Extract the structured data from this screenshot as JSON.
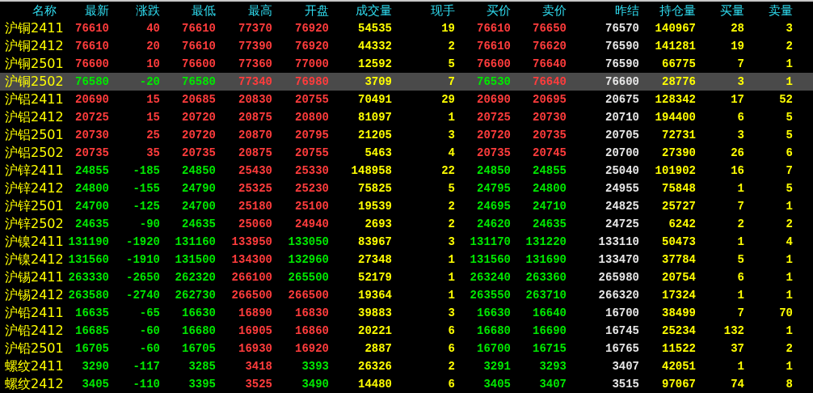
{
  "columns": [
    {
      "label": "名称",
      "kind": "name"
    },
    {
      "label": "最新",
      "kind": "price"
    },
    {
      "label": "涨跌",
      "kind": "price"
    },
    {
      "label": "最低",
      "kind": "price"
    },
    {
      "label": "最高",
      "kind": "price"
    },
    {
      "label": "开盘",
      "kind": "price"
    },
    {
      "label": "成交量",
      "kind": "volume"
    },
    {
      "label": "现手",
      "kind": "volume"
    },
    {
      "label": "买价",
      "kind": "price"
    },
    {
      "label": "卖价",
      "kind": "price"
    },
    {
      "label": "昨结",
      "kind": "settle"
    },
    {
      "label": "持仓量",
      "kind": "volume"
    },
    {
      "label": "买量",
      "kind": "volume"
    },
    {
      "label": "卖量",
      "kind": "volume"
    }
  ],
  "rows": [
    {
      "selected": false,
      "name": "沪铜2411",
      "cells": [
        {
          "text": "76610",
          "color": "#ff3c3c"
        },
        {
          "text": "40",
          "color": "#ff3c3c"
        },
        {
          "text": "76610",
          "color": "#ff3c3c"
        },
        {
          "text": "77370",
          "color": "#ff3c3c"
        },
        {
          "text": "76920",
          "color": "#ff3c3c"
        },
        "54535",
        "19",
        {
          "text": "76610",
          "color": "#ff3c3c"
        },
        {
          "text": "76650",
          "color": "#ff3c3c"
        },
        "76570",
        "140967",
        "28",
        "3"
      ]
    },
    {
      "selected": false,
      "name": "沪铜2412",
      "cells": [
        {
          "text": "76610",
          "color": "#ff3c3c"
        },
        {
          "text": "20",
          "color": "#ff3c3c"
        },
        {
          "text": "76610",
          "color": "#ff3c3c"
        },
        {
          "text": "77390",
          "color": "#ff3c3c"
        },
        {
          "text": "76920",
          "color": "#ff3c3c"
        },
        "44332",
        "2",
        {
          "text": "76610",
          "color": "#ff3c3c"
        },
        {
          "text": "76620",
          "color": "#ff3c3c"
        },
        "76590",
        "141281",
        "19",
        "2"
      ]
    },
    {
      "selected": false,
      "name": "沪铜2501",
      "cells": [
        {
          "text": "76600",
          "color": "#ff3c3c"
        },
        {
          "text": "10",
          "color": "#ff3c3c"
        },
        {
          "text": "76600",
          "color": "#ff3c3c"
        },
        {
          "text": "77360",
          "color": "#ff3c3c"
        },
        {
          "text": "77000",
          "color": "#ff3c3c"
        },
        "12592",
        "5",
        {
          "text": "76600",
          "color": "#ff3c3c"
        },
        {
          "text": "76640",
          "color": "#ff3c3c"
        },
        "76590",
        "66775",
        "7",
        "1"
      ]
    },
    {
      "selected": true,
      "name": "沪铜2502",
      "cells": [
        {
          "text": "76580",
          "color": "#00e800"
        },
        {
          "text": "-20",
          "color": "#00e800"
        },
        {
          "text": "76580",
          "color": "#00e800"
        },
        {
          "text": "77340",
          "color": "#ff3c3c"
        },
        {
          "text": "76980",
          "color": "#ff3c3c"
        },
        "3709",
        "7",
        {
          "text": "76530",
          "color": "#00e800"
        },
        {
          "text": "76640",
          "color": "#ff3c3c"
        },
        "76600",
        "28776",
        "3",
        "1"
      ]
    },
    {
      "selected": false,
      "name": "沪铝2411",
      "cells": [
        {
          "text": "20690",
          "color": "#ff3c3c"
        },
        {
          "text": "15",
          "color": "#ff3c3c"
        },
        {
          "text": "20685",
          "color": "#ff3c3c"
        },
        {
          "text": "20830",
          "color": "#ff3c3c"
        },
        {
          "text": "20755",
          "color": "#ff3c3c"
        },
        "70491",
        "29",
        {
          "text": "20690",
          "color": "#ff3c3c"
        },
        {
          "text": "20695",
          "color": "#ff3c3c"
        },
        "20675",
        "128342",
        "17",
        "52"
      ]
    },
    {
      "selected": false,
      "name": "沪铝2412",
      "cells": [
        {
          "text": "20725",
          "color": "#ff3c3c"
        },
        {
          "text": "15",
          "color": "#ff3c3c"
        },
        {
          "text": "20720",
          "color": "#ff3c3c"
        },
        {
          "text": "20875",
          "color": "#ff3c3c"
        },
        {
          "text": "20800",
          "color": "#ff3c3c"
        },
        "81097",
        "1",
        {
          "text": "20725",
          "color": "#ff3c3c"
        },
        {
          "text": "20730",
          "color": "#ff3c3c"
        },
        "20710",
        "194400",
        "6",
        "5"
      ]
    },
    {
      "selected": false,
      "name": "沪铝2501",
      "cells": [
        {
          "text": "20730",
          "color": "#ff3c3c"
        },
        {
          "text": "25",
          "color": "#ff3c3c"
        },
        {
          "text": "20720",
          "color": "#ff3c3c"
        },
        {
          "text": "20870",
          "color": "#ff3c3c"
        },
        {
          "text": "20795",
          "color": "#ff3c3c"
        },
        "21205",
        "3",
        {
          "text": "20720",
          "color": "#ff3c3c"
        },
        {
          "text": "20735",
          "color": "#ff3c3c"
        },
        "20705",
        "72731",
        "3",
        "5"
      ]
    },
    {
      "selected": false,
      "name": "沪铝2502",
      "cells": [
        {
          "text": "20735",
          "color": "#ff3c3c"
        },
        {
          "text": "35",
          "color": "#ff3c3c"
        },
        {
          "text": "20735",
          "color": "#ff3c3c"
        },
        {
          "text": "20875",
          "color": "#ff3c3c"
        },
        {
          "text": "20755",
          "color": "#ff3c3c"
        },
        "5463",
        "4",
        {
          "text": "20735",
          "color": "#ff3c3c"
        },
        {
          "text": "20745",
          "color": "#ff3c3c"
        },
        "20700",
        "27390",
        "26",
        "6"
      ]
    },
    {
      "selected": false,
      "name": "沪锌2411",
      "cells": [
        {
          "text": "24855",
          "color": "#00e800"
        },
        {
          "text": "-185",
          "color": "#00e800"
        },
        {
          "text": "24850",
          "color": "#00e800"
        },
        {
          "text": "25430",
          "color": "#ff3c3c"
        },
        {
          "text": "25330",
          "color": "#ff3c3c"
        },
        "148958",
        "22",
        {
          "text": "24850",
          "color": "#00e800"
        },
        {
          "text": "24855",
          "color": "#00e800"
        },
        "25040",
        "101902",
        "16",
        "7"
      ]
    },
    {
      "selected": false,
      "name": "沪锌2412",
      "cells": [
        {
          "text": "24800",
          "color": "#00e800"
        },
        {
          "text": "-155",
          "color": "#00e800"
        },
        {
          "text": "24790",
          "color": "#00e800"
        },
        {
          "text": "25325",
          "color": "#ff3c3c"
        },
        {
          "text": "25230",
          "color": "#ff3c3c"
        },
        "75825",
        "5",
        {
          "text": "24795",
          "color": "#00e800"
        },
        {
          "text": "24800",
          "color": "#00e800"
        },
        "24955",
        "75848",
        "1",
        "5"
      ]
    },
    {
      "selected": false,
      "name": "沪锌2501",
      "cells": [
        {
          "text": "24700",
          "color": "#00e800"
        },
        {
          "text": "-125",
          "color": "#00e800"
        },
        {
          "text": "24700",
          "color": "#00e800"
        },
        {
          "text": "25180",
          "color": "#ff3c3c"
        },
        {
          "text": "25100",
          "color": "#ff3c3c"
        },
        "19539",
        "2",
        {
          "text": "24695",
          "color": "#00e800"
        },
        {
          "text": "24710",
          "color": "#00e800"
        },
        "24825",
        "25727",
        "7",
        "1"
      ]
    },
    {
      "selected": false,
      "name": "沪锌2502",
      "cells": [
        {
          "text": "24635",
          "color": "#00e800"
        },
        {
          "text": "-90",
          "color": "#00e800"
        },
        {
          "text": "24635",
          "color": "#00e800"
        },
        {
          "text": "25060",
          "color": "#ff3c3c"
        },
        {
          "text": "24940",
          "color": "#ff3c3c"
        },
        "2693",
        "2",
        {
          "text": "24620",
          "color": "#00e800"
        },
        {
          "text": "24635",
          "color": "#00e800"
        },
        "24725",
        "6242",
        "2",
        "2"
      ]
    },
    {
      "selected": false,
      "name": "沪镍2411",
      "cells": [
        {
          "text": "131190",
          "color": "#00e800"
        },
        {
          "text": "-1920",
          "color": "#00e800"
        },
        {
          "text": "131160",
          "color": "#00e800"
        },
        {
          "text": "133950",
          "color": "#ff3c3c"
        },
        {
          "text": "133050",
          "color": "#00e800"
        },
        "83967",
        "3",
        {
          "text": "131170",
          "color": "#00e800"
        },
        {
          "text": "131220",
          "color": "#00e800"
        },
        "133110",
        "50473",
        "1",
        "4"
      ]
    },
    {
      "selected": false,
      "name": "沪镍2412",
      "cells": [
        {
          "text": "131560",
          "color": "#00e800"
        },
        {
          "text": "-1910",
          "color": "#00e800"
        },
        {
          "text": "131500",
          "color": "#00e800"
        },
        {
          "text": "134300",
          "color": "#ff3c3c"
        },
        {
          "text": "132960",
          "color": "#00e800"
        },
        "27348",
        "1",
        {
          "text": "131560",
          "color": "#00e800"
        },
        {
          "text": "131690",
          "color": "#00e800"
        },
        "133470",
        "37784",
        "5",
        "1"
      ]
    },
    {
      "selected": false,
      "name": "沪锡2411",
      "cells": [
        {
          "text": "263330",
          "color": "#00e800"
        },
        {
          "text": "-2650",
          "color": "#00e800"
        },
        {
          "text": "262320",
          "color": "#00e800"
        },
        {
          "text": "266100",
          "color": "#ff3c3c"
        },
        {
          "text": "265500",
          "color": "#00e800"
        },
        "52179",
        "1",
        {
          "text": "263240",
          "color": "#00e800"
        },
        {
          "text": "263360",
          "color": "#00e800"
        },
        "265980",
        "20754",
        "6",
        "1"
      ]
    },
    {
      "selected": false,
      "name": "沪锡2412",
      "cells": [
        {
          "text": "263580",
          "color": "#00e800"
        },
        {
          "text": "-2740",
          "color": "#00e800"
        },
        {
          "text": "262730",
          "color": "#00e800"
        },
        {
          "text": "266500",
          "color": "#ff3c3c"
        },
        {
          "text": "266500",
          "color": "#ff3c3c"
        },
        "19364",
        "1",
        {
          "text": "263550",
          "color": "#00e800"
        },
        {
          "text": "263710",
          "color": "#00e800"
        },
        "266320",
        "17324",
        "1",
        "1"
      ]
    },
    {
      "selected": false,
      "name": "沪铅2411",
      "cells": [
        {
          "text": "16635",
          "color": "#00e800"
        },
        {
          "text": "-65",
          "color": "#00e800"
        },
        {
          "text": "16630",
          "color": "#00e800"
        },
        {
          "text": "16890",
          "color": "#ff3c3c"
        },
        {
          "text": "16830",
          "color": "#ff3c3c"
        },
        "39883",
        "3",
        {
          "text": "16630",
          "color": "#00e800"
        },
        {
          "text": "16640",
          "color": "#00e800"
        },
        "16700",
        "38499",
        "7",
        "70"
      ]
    },
    {
      "selected": false,
      "name": "沪铅2412",
      "cells": [
        {
          "text": "16685",
          "color": "#00e800"
        },
        {
          "text": "-60",
          "color": "#00e800"
        },
        {
          "text": "16680",
          "color": "#00e800"
        },
        {
          "text": "16905",
          "color": "#ff3c3c"
        },
        {
          "text": "16860",
          "color": "#ff3c3c"
        },
        "20221",
        "6",
        {
          "text": "16680",
          "color": "#00e800"
        },
        {
          "text": "16690",
          "color": "#00e800"
        },
        "16745",
        "25234",
        "132",
        "1"
      ]
    },
    {
      "selected": false,
      "name": "沪铅2501",
      "cells": [
        {
          "text": "16705",
          "color": "#00e800"
        },
        {
          "text": "-60",
          "color": "#00e800"
        },
        {
          "text": "16705",
          "color": "#00e800"
        },
        {
          "text": "16930",
          "color": "#ff3c3c"
        },
        {
          "text": "16920",
          "color": "#ff3c3c"
        },
        "2887",
        "6",
        {
          "text": "16700",
          "color": "#00e800"
        },
        {
          "text": "16715",
          "color": "#00e800"
        },
        "16765",
        "11522",
        "37",
        "2"
      ]
    },
    {
      "selected": false,
      "name": "螺纹2411",
      "cells": [
        {
          "text": "3290",
          "color": "#00e800"
        },
        {
          "text": "-117",
          "color": "#00e800"
        },
        {
          "text": "3285",
          "color": "#00e800"
        },
        {
          "text": "3418",
          "color": "#ff3c3c"
        },
        {
          "text": "3393",
          "color": "#00e800"
        },
        "26326",
        "2",
        {
          "text": "3291",
          "color": "#00e800"
        },
        {
          "text": "3293",
          "color": "#00e800"
        },
        "3407",
        "42051",
        "1",
        "1"
      ]
    },
    {
      "selected": false,
      "name": "螺纹2412",
      "cells": [
        {
          "text": "3405",
          "color": "#00e800"
        },
        {
          "text": "-110",
          "color": "#00e800"
        },
        {
          "text": "3395",
          "color": "#00e800"
        },
        {
          "text": "3525",
          "color": "#ff3c3c"
        },
        {
          "text": "3490",
          "color": "#00e800"
        },
        "14480",
        "6",
        {
          "text": "3405",
          "color": "#00e800"
        },
        {
          "text": "3407",
          "color": "#00e800"
        },
        "3515",
        "97067",
        "74",
        "8"
      ]
    }
  ]
}
